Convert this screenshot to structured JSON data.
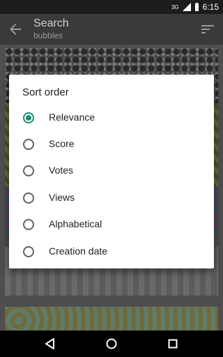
{
  "status_bar": {
    "network": "3G",
    "time": "6:15"
  },
  "app_bar": {
    "title": "Search",
    "subtitle": "bubbles",
    "back_icon": "arrow-back-icon",
    "sort_icon": "sort-icon"
  },
  "dialog": {
    "title": "Sort order",
    "options": [
      {
        "label": "Relevance",
        "selected": true
      },
      {
        "label": "Score",
        "selected": false
      },
      {
        "label": "Votes",
        "selected": false
      },
      {
        "label": "Views",
        "selected": false
      },
      {
        "label": "Alphabetical",
        "selected": false
      },
      {
        "label": "Creation date",
        "selected": false
      }
    ]
  },
  "nav_bar": {
    "back_icon": "nav-back-icon",
    "home_icon": "nav-home-icon",
    "recents_icon": "nav-recents-icon"
  },
  "colors": {
    "accent": "#1d8a7a",
    "dialog_bg": "#ffffff",
    "app_bar": "#3a3a3a"
  }
}
